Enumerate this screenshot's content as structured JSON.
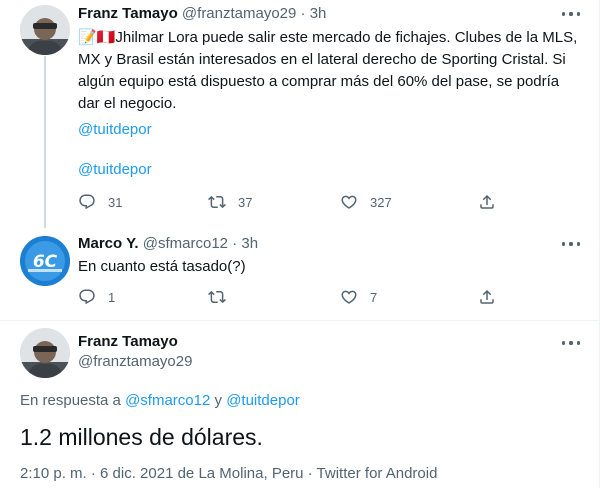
{
  "tweets": [
    {
      "name": "Franz Tamayo",
      "handle": "@franztamayo29",
      "separator": "·",
      "time": "3h",
      "emoji_prefix": "📝🇵🇪",
      "text": "Jhilmar Lora puede salir este mercado de fichajes. Clubes de la MLS, MX y Brasil están interesados en el lateral derecho de Sporting Cristal. Si algún equipo está dispuesto a comprar más del 60% del pase, se podría dar el negocio.",
      "link1": "@tuitdepor",
      "link2": "@tuitdepor",
      "replies": "31",
      "retweets": "37",
      "likes": "327"
    },
    {
      "name": "Marco Y.",
      "handle": "@sfmarco12",
      "separator": "·",
      "time": "3h",
      "text": "En cuanto está tasado(?)",
      "replies": "1",
      "retweets": "",
      "likes": "7"
    },
    {
      "name": "Franz Tamayo",
      "handle": "@franztamayo29",
      "reply_prefix": "En respuesta a",
      "reply_user1": "@sfmarco12",
      "reply_conj": "y",
      "reply_user2": "@tuitdepor",
      "text": "1.2 millones de dólares.",
      "meta": "2:10 p. m. · 6 dic. 2021 de La Molina, Peru · Twitter for Android"
    }
  ],
  "icons": {
    "reply": "reply-icon",
    "retweet": "retweet-icon",
    "like": "heart-icon",
    "share": "share-icon",
    "more": "more-icon"
  },
  "colors": {
    "link": "#1d9bf0",
    "secondary": "#536471",
    "text": "#0f1419",
    "thread_line": "#cfd9de",
    "marco_avatar": "#1d7fd1"
  }
}
